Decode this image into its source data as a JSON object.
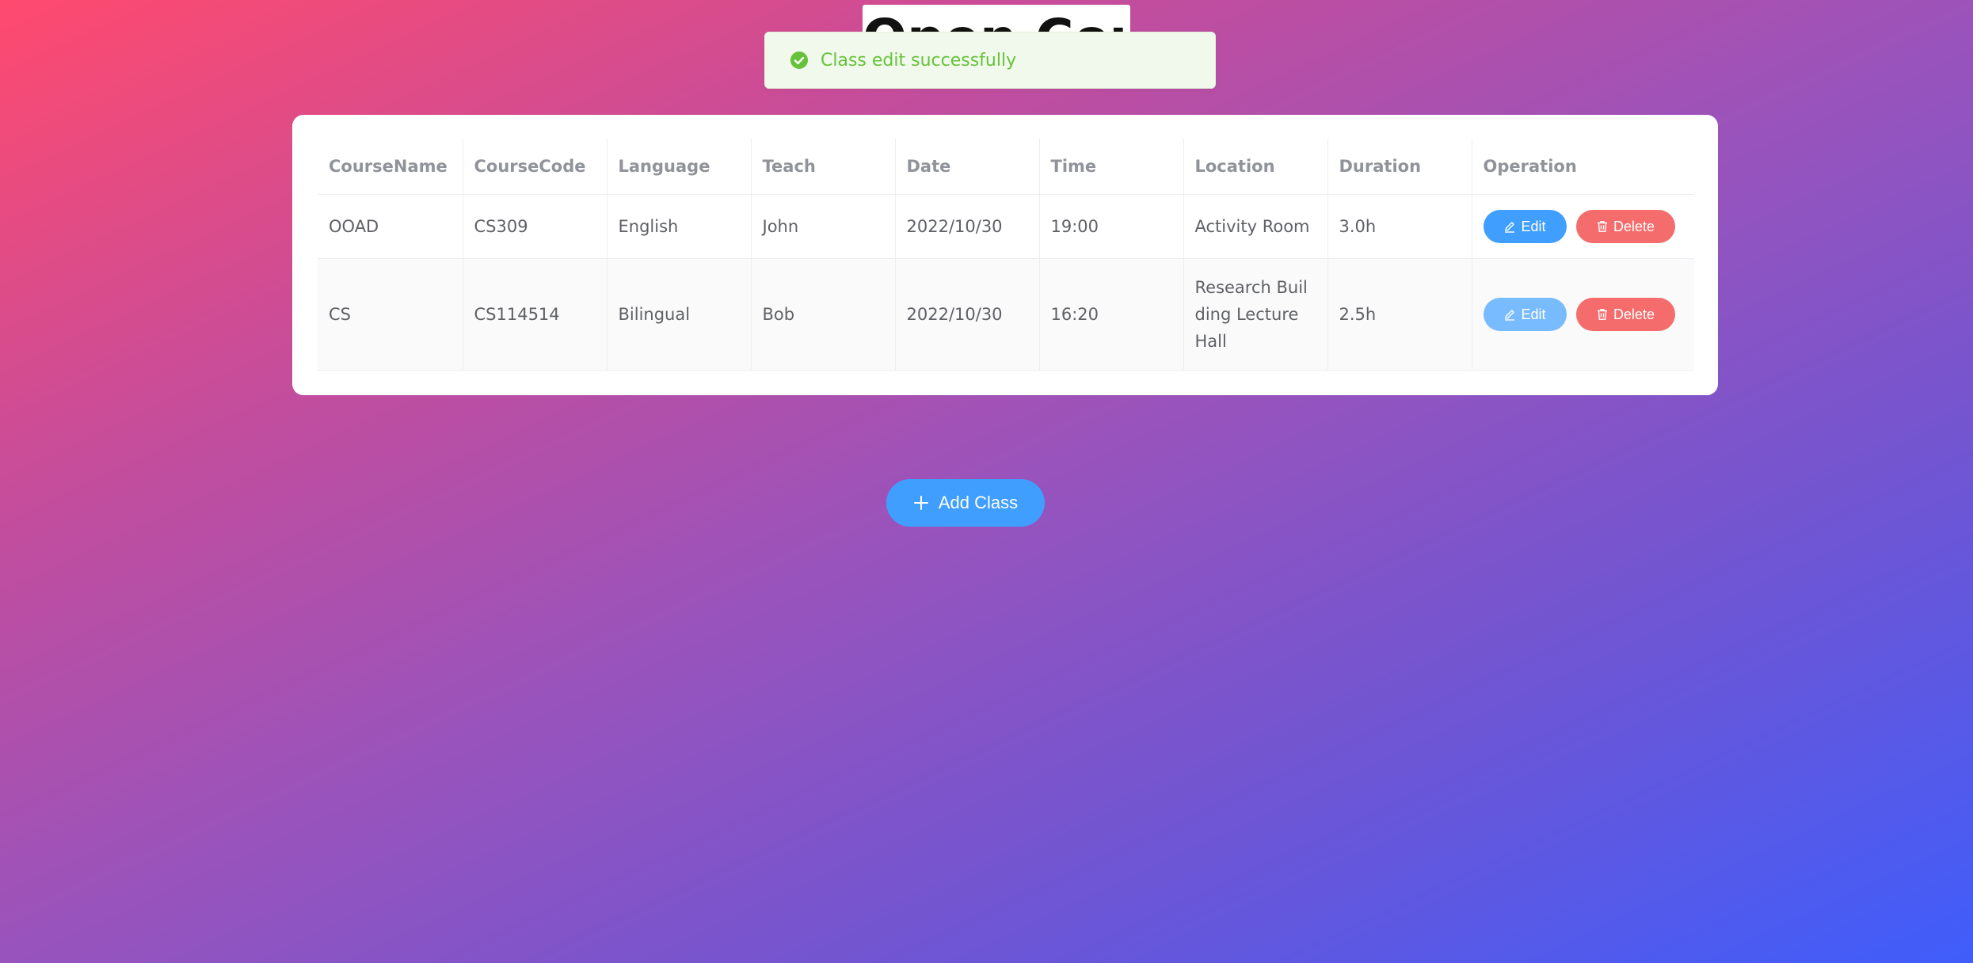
{
  "page": {
    "title": "Open Courses"
  },
  "toast": {
    "message": "Class edit successfully",
    "icon": "check-circle-icon",
    "color": "#67c23a"
  },
  "table": {
    "columns": [
      "CourseName",
      "CourseCode",
      "Language",
      "Teach",
      "Date",
      "Time",
      "Location",
      "Duration",
      "Operation"
    ],
    "rows": [
      {
        "course_name": "OOAD",
        "course_code": "CS309",
        "language": "English",
        "teach": "John",
        "date": "2022/10/30",
        "time": "19:00",
        "location": "Activity Room",
        "duration": "3.0h",
        "edit_label": "Edit",
        "delete_label": "Delete"
      },
      {
        "course_name": "CS",
        "course_code": "CS114514",
        "language": "Bilingual",
        "teach": "Bob",
        "date": "2022/10/30",
        "time": "16:20",
        "location": "Research Building Lecture Hall",
        "duration": "2.5h",
        "edit_label": "Edit",
        "delete_label": "Delete"
      }
    ]
  },
  "actions": {
    "add_class_label": "Add Class"
  },
  "colors": {
    "primary": "#409eff",
    "danger": "#f56c6c",
    "success": "#67c23a"
  }
}
